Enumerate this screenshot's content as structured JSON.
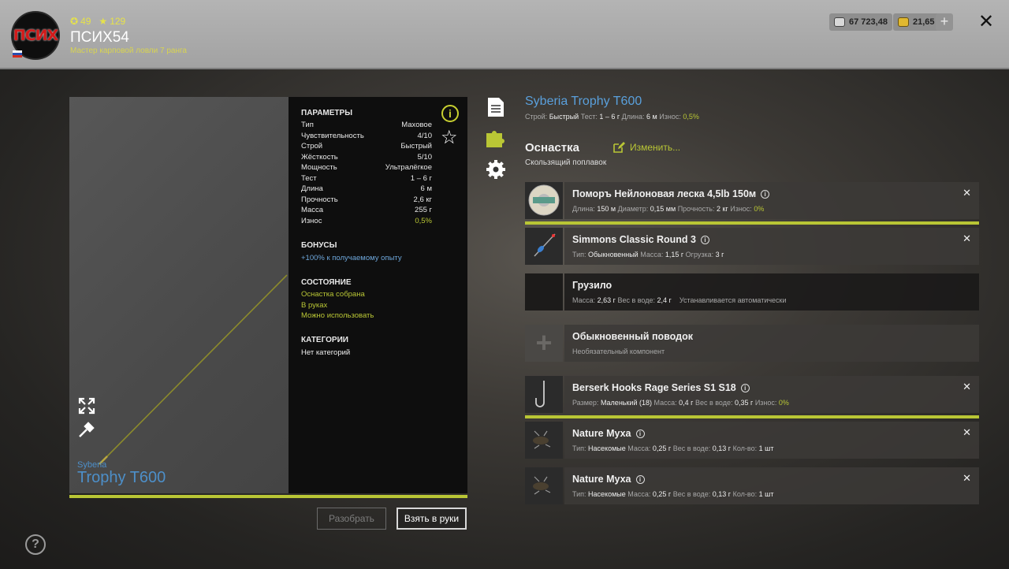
{
  "player": {
    "avatar_text": "ПСИХ",
    "level": "49",
    "rating": "129",
    "nickname": "ПСИХ54",
    "rank": "Мастер карповой ловли 7 ранга"
  },
  "currency": {
    "silver": "67 723,48",
    "gold": "21,65"
  },
  "preview": {
    "brand": "Syberia",
    "title": "Trophy T600"
  },
  "params": {
    "section_params": "ПАРАМЕТРЫ",
    "rows": [
      {
        "label": "Тип",
        "value": "Маховое"
      },
      {
        "label": "Чувствительность",
        "value": "4/10"
      },
      {
        "label": "Строй",
        "value": "Быстрый"
      },
      {
        "label": "Жёсткость",
        "value": "5/10"
      },
      {
        "label": "Мощность",
        "value": "Ультралёгкое"
      },
      {
        "label": "Тест",
        "value": "1 – 6 г"
      },
      {
        "label": "Длина",
        "value": "6 м"
      },
      {
        "label": "Прочность",
        "value": "2,6 кг"
      },
      {
        "label": "Масса",
        "value": "255 г"
      },
      {
        "label": "Износ",
        "value": "0,5%"
      }
    ],
    "section_bonus": "БОНУСЫ",
    "bonus": "+100% к получаемому опыту",
    "section_state": "СОСТОЯНИЕ",
    "state": [
      "Оснастка собрана",
      "В руках",
      "Можно использовать"
    ],
    "section_cat": "КАТЕГОРИИ",
    "categories": "Нет категорий"
  },
  "buttons": {
    "disassemble": "Разобрать",
    "take": "Взять в руки"
  },
  "rod": {
    "title": "Syberia Trophy T600",
    "stroy_l": "Строй:",
    "stroy_v": "Быстрый",
    "test_l": "Тест:",
    "test_v": "1 – 6 г",
    "len_l": "Длина:",
    "len_v": "6 м",
    "wear_l": "Износ:",
    "wear_v": "0,5%"
  },
  "rig": {
    "heading": "Оснастка",
    "edit": "Изменить...",
    "type": "Скользящий поплавок"
  },
  "items": [
    {
      "name": "Поморъ Нейлоновая леска 4,5lb 150м",
      "d": [
        [
          "Длина:",
          "150 м"
        ],
        [
          "Диаметр:",
          "0,15 мм"
        ],
        [
          "Прочность:",
          "2 кг"
        ],
        [
          "Износ:",
          "0%"
        ]
      ]
    },
    {
      "name": "Simmons Classic Round 3",
      "d": [
        [
          "Тип:",
          "Обыкновенный"
        ],
        [
          "Масса:",
          "1,15 г"
        ],
        [
          "Огрузка:",
          "3 г"
        ]
      ]
    },
    {
      "name": "Грузило",
      "d": [
        [
          "Масса:",
          "2,63 г"
        ],
        [
          "Вес в воде:",
          "2,4 г"
        ]
      ],
      "note": "Устанавливается автоматически"
    },
    {
      "name": "Обыкновенный поводок",
      "note": "Необязательный компонент"
    },
    {
      "name": "Berserk Hooks Rage Series S1 S18",
      "d": [
        [
          "Размер:",
          "Маленький (18)"
        ],
        [
          "Масса:",
          "0,4 г"
        ],
        [
          "Вес в воде:",
          "0,35 г"
        ],
        [
          "Износ:",
          "0%"
        ]
      ]
    },
    {
      "name": "Nature Муха",
      "d": [
        [
          "Тип:",
          "Насекомые"
        ],
        [
          "Масса:",
          "0,25 г"
        ],
        [
          "Вес в воде:",
          "0,13 г"
        ],
        [
          "Кол-во:",
          "1 шт"
        ]
      ]
    },
    {
      "name": "Nature Муха",
      "d": [
        [
          "Тип:",
          "Насекомые"
        ],
        [
          "Масса:",
          "0,25 г"
        ],
        [
          "Вес в воде:",
          "0,13 г"
        ],
        [
          "Кол-во:",
          "1 шт"
        ]
      ]
    }
  ],
  "colors": {
    "accent": "#b9c635",
    "link": "#5aa0dc",
    "brand": "#4d8fc9"
  }
}
